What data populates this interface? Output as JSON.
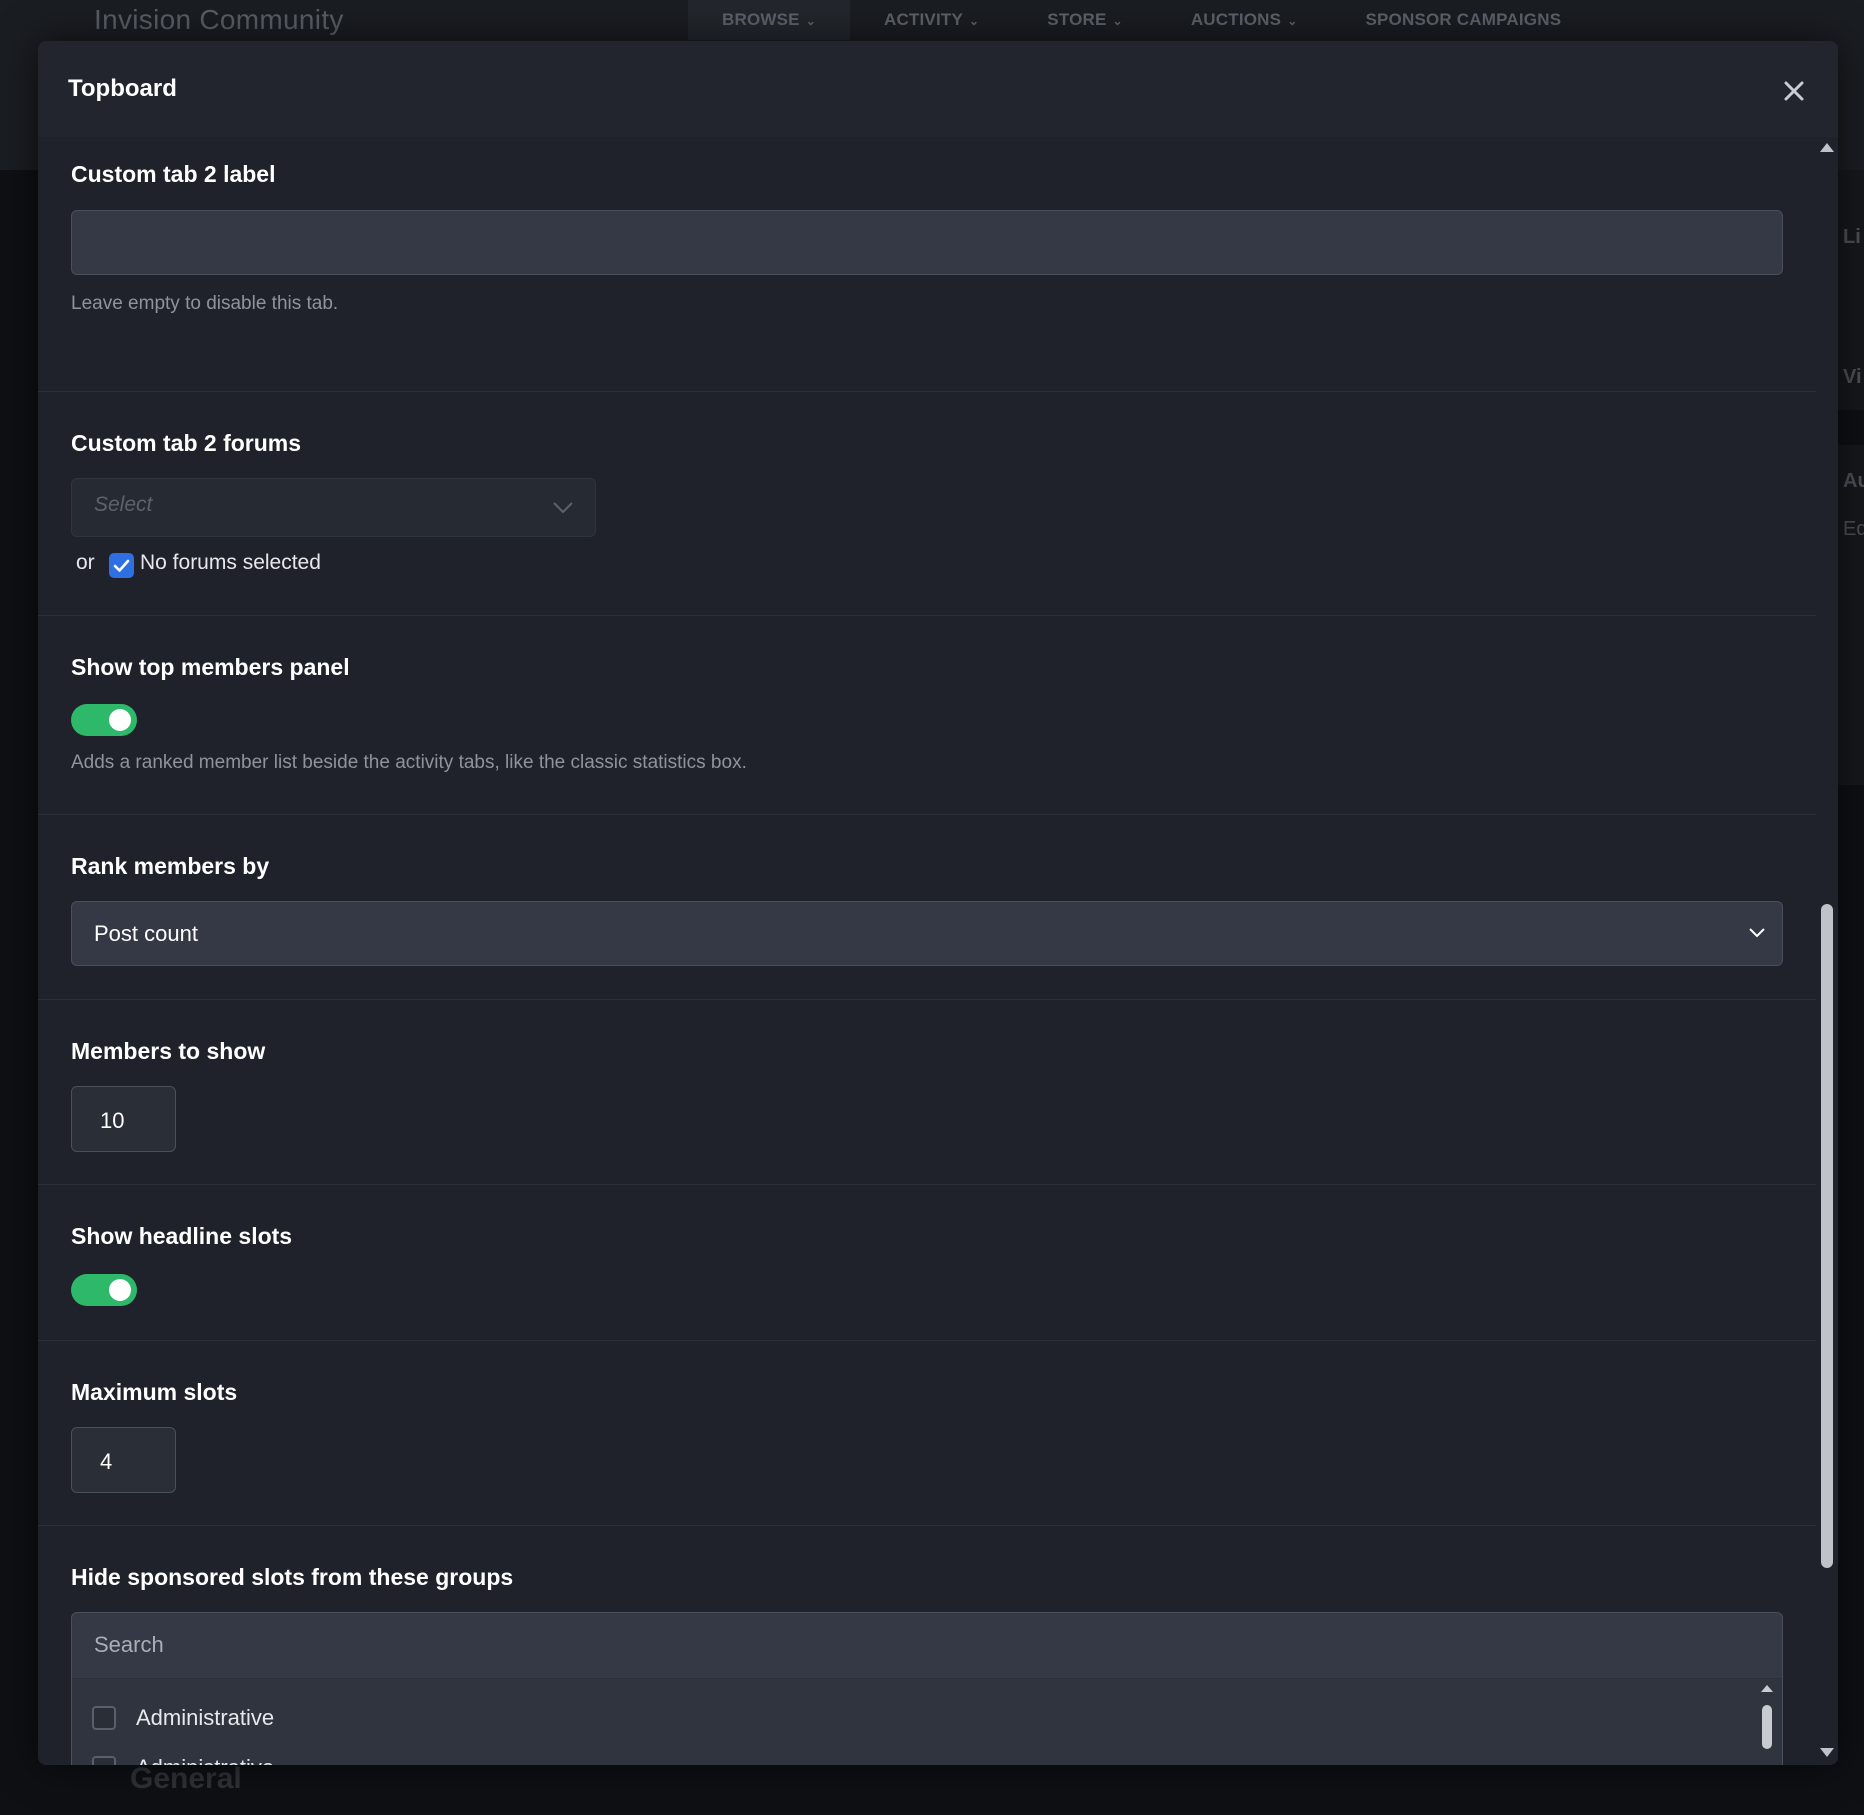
{
  "background": {
    "brand": "Invision Community",
    "nav": [
      {
        "label": "BROWSE",
        "dropdown": true,
        "active": true
      },
      {
        "label": "ACTIVITY",
        "dropdown": true,
        "active": false
      },
      {
        "label": "STORE",
        "dropdown": true,
        "active": false
      },
      {
        "label": "AUCTIONS",
        "dropdown": true,
        "active": false
      },
      {
        "label": "SPONSOR CAMPAIGNS",
        "dropdown": false,
        "active": false
      }
    ],
    "right_fragments": [
      "Li",
      "Vi",
      "Au",
      "Eq"
    ],
    "footer_heading": "General"
  },
  "modal": {
    "title": "Topboard",
    "close_icon": "close-icon"
  },
  "form": {
    "custom_tab_label": {
      "label": "Custom tab 2 label",
      "value": "",
      "hint": "Leave empty to disable this tab."
    },
    "custom_tab_forums": {
      "label": "Custom tab 2 forums",
      "placeholder": "Select",
      "or_text": "or",
      "checkbox_label": "No forums selected",
      "checkbox_checked": true
    },
    "show_top_members": {
      "label": "Show top members panel",
      "enabled": true,
      "hint": "Adds a ranked member list beside the activity tabs, like the classic statistics box."
    },
    "rank_members_by": {
      "label": "Rank members by",
      "value": "Post count"
    },
    "members_to_show": {
      "label": "Members to show",
      "value": "10"
    },
    "show_headline_slots": {
      "label": "Show headline slots",
      "enabled": true
    },
    "maximum_slots": {
      "label": "Maximum slots",
      "value": "4"
    },
    "hide_sponsored": {
      "label": "Hide sponsored slots from these groups",
      "search_placeholder": "Search",
      "options": [
        {
          "label": "Administrative",
          "checked": false
        },
        {
          "label": "Administrative",
          "checked": false
        }
      ]
    }
  },
  "colors": {
    "toggle_on": "#2eb86a",
    "checkbox_on": "#2f6fe4",
    "modal_bg": "#1f222a"
  }
}
